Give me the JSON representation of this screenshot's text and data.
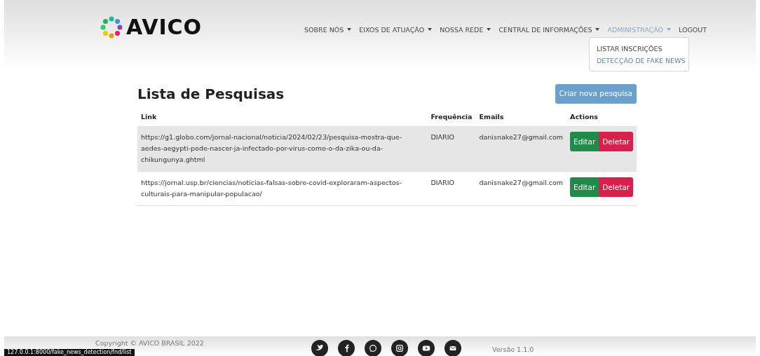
{
  "brand": {
    "name": "AVICO"
  },
  "nav": [
    {
      "label": "SOBRE NÓS",
      "dropdown": true,
      "active": false
    },
    {
      "label": "EIXOS DE ATUAÇÃO",
      "dropdown": true,
      "active": false
    },
    {
      "label": "NOSSA REDE",
      "dropdown": true,
      "active": false
    },
    {
      "label": "CENTRAL DE INFORMAÇÕES",
      "dropdown": true,
      "active": false
    },
    {
      "label": "ADMINISTRAÇÃO",
      "dropdown": true,
      "active": true
    },
    {
      "label": "LOGOUT",
      "dropdown": false,
      "active": false
    }
  ],
  "dropdown_menu": [
    {
      "label": "LISTAR INSCRIÇÕES",
      "selected": false
    },
    {
      "label": "DETECÇÃO DE FAKE NEWS",
      "selected": true
    }
  ],
  "page": {
    "title": "Lista de Pesquisas",
    "new_button": "Criar nova pesquisa"
  },
  "table": {
    "columns": [
      "Link",
      "Frequência",
      "Emails",
      "Actions"
    ],
    "rows": [
      {
        "link": "https://g1.globo.com/jornal-nacional/noticia/2024/02/23/pesquisa-mostra-que-aedes-aegypti-pode-nascer-ja-infectado-por-virus-como-o-da-zika-ou-da-chikungunya.ghtml",
        "frequency": "DIARIO",
        "email": "danisnake27@gmail.com",
        "edit": "Editar",
        "delete": "Deletar",
        "selected": true
      },
      {
        "link": "https://jornal.usp.br/ciencias/noticias-falsas-sobre-covid-exploraram-aspectos-culturais-para-manipular-populacao/",
        "frequency": "DIARIO",
        "email": "danisnake27@gmail.com",
        "edit": "Editar",
        "delete": "Deletar",
        "selected": false
      }
    ]
  },
  "footer": {
    "copyright": "Copyright © AVICO BRASIL 2022",
    "social": [
      {
        "kind": "twitter"
      },
      {
        "kind": "facebook"
      },
      {
        "kind": "whatsapp"
      },
      {
        "kind": "instagram"
      },
      {
        "kind": "youtube"
      },
      {
        "kind": "email"
      }
    ],
    "version": "Versão 1.1.0"
  },
  "status_bar": "127.0.0.1:8000/fake_news_detection/fnd/list"
}
